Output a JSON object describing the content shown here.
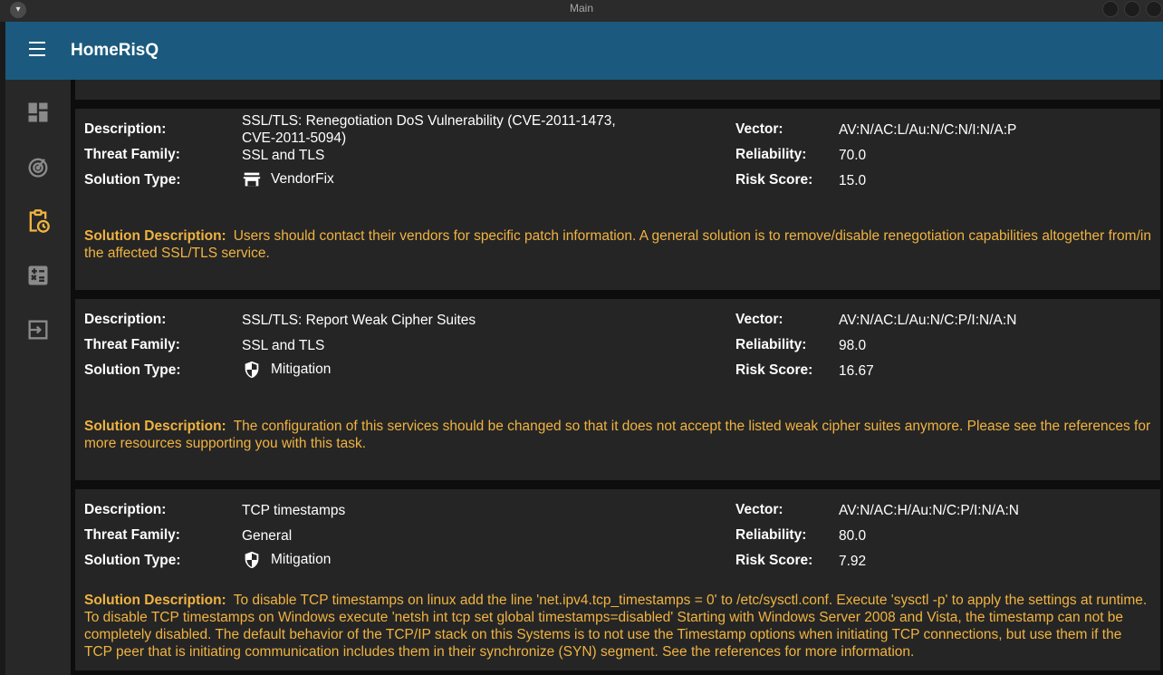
{
  "window": {
    "title": "Main"
  },
  "app": {
    "title": "HomeRisQ"
  },
  "labels": {
    "description": "Description:",
    "threat_family": "Threat Family:",
    "solution_type": "Solution Type:",
    "vector": "Vector:",
    "reliability": "Reliability:",
    "risk_score": "Risk Score:",
    "solution_description": "Solution Description:"
  },
  "sidebar": {
    "items": [
      {
        "icon": "dashboard-icon"
      },
      {
        "icon": "radar-icon"
      },
      {
        "icon": "clipboard-clock-icon",
        "active": true
      },
      {
        "icon": "calculator-icon"
      },
      {
        "icon": "logout-icon"
      }
    ]
  },
  "colors": {
    "accent": "#f0b341",
    "appbar": "#1b5a7e",
    "card": "#252525"
  },
  "vulnerabilities": [
    {
      "description": "SSL/TLS: Renegotiation DoS Vulnerability (CVE-2011-1473, CVE-2011-5094)",
      "threat_family": "SSL and TLS",
      "solution_type": "VendorFix",
      "solution_icon": "store-icon",
      "vector": "AV:N/AC:L/Au:N/C:N/I:N/A:P",
      "reliability": "70.0",
      "risk_score": "15.0",
      "solution_description": "Users should contact their vendors for specific patch information.  A general solution is to remove/disable renegotiation capabilities altogether from/in the affected  SSL/TLS service."
    },
    {
      "description": "SSL/TLS: Report Weak Cipher Suites",
      "threat_family": "SSL and TLS",
      "solution_type": "Mitigation",
      "solution_icon": "shield-icon",
      "vector": "AV:N/AC:L/Au:N/C:P/I:N/A:N",
      "reliability": "98.0",
      "risk_score": "16.67",
      "solution_description": "The configuration of this services should be changed so  that it does not accept the listed weak cipher suites anymore.  Please see the references for more resources supporting you with this task."
    },
    {
      "description": "TCP timestamps",
      "threat_family": "General",
      "solution_type": "Mitigation",
      "solution_icon": "shield-icon",
      "vector": "AV:N/AC:H/Au:N/C:P/I:N/A:N",
      "reliability": "80.0",
      "risk_score": "7.92",
      "solution_description": "To disable TCP timestamps on linux add the line 'net.ipv4.tcp_timestamps = 0' to  /etc/sysctl.conf. Execute 'sysctl -p' to apply the settings at runtime.  To disable TCP timestamps on Windows execute 'netsh int tcp set global timestamps=disabled'  Starting with Windows Server 2008 and Vista, the timestamp can not be completely disabled.  The default behavior of the TCP/IP stack on this Systems is to not use the  Timestamp options when initiating TCP connections, but use them if the TCP peer  that is initiating communication includes them in their synchronize (SYN) segment.  See the references for more information."
    }
  ]
}
